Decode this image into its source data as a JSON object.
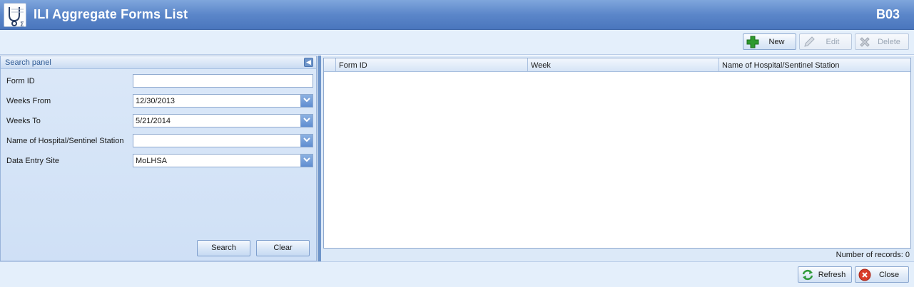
{
  "window": {
    "title": "ILI Aggregate Forms List",
    "code": "B03",
    "icon": "stethoscope-sigma-icon"
  },
  "toolbar": {
    "new_label": "New",
    "edit_label": "Edit",
    "delete_label": "Delete"
  },
  "search_panel": {
    "title": "Search panel",
    "fields": {
      "form_id": {
        "label": "Form ID",
        "value": ""
      },
      "weeks_from": {
        "label": "Weeks From",
        "value": "12/30/2013"
      },
      "weeks_to": {
        "label": "Weeks To",
        "value": "5/21/2014"
      },
      "hospital": {
        "label": "Name of Hospital/Sentinel Station",
        "value": ""
      },
      "data_entry_site": {
        "label": "Data Entry Site",
        "value": "MoLHSA"
      }
    },
    "search_label": "Search",
    "clear_label": "Clear"
  },
  "grid": {
    "columns": [
      "Form ID",
      "Week",
      "Name of Hospital/Sentinel Station"
    ],
    "rows": [],
    "records_text": "Number of records: 0"
  },
  "footer": {
    "refresh_label": "Refresh",
    "close_label": "Close"
  },
  "colors": {
    "titlebar": "#5b86c9",
    "panel": "#cfe0f6",
    "splitter": "#6f95c9"
  }
}
